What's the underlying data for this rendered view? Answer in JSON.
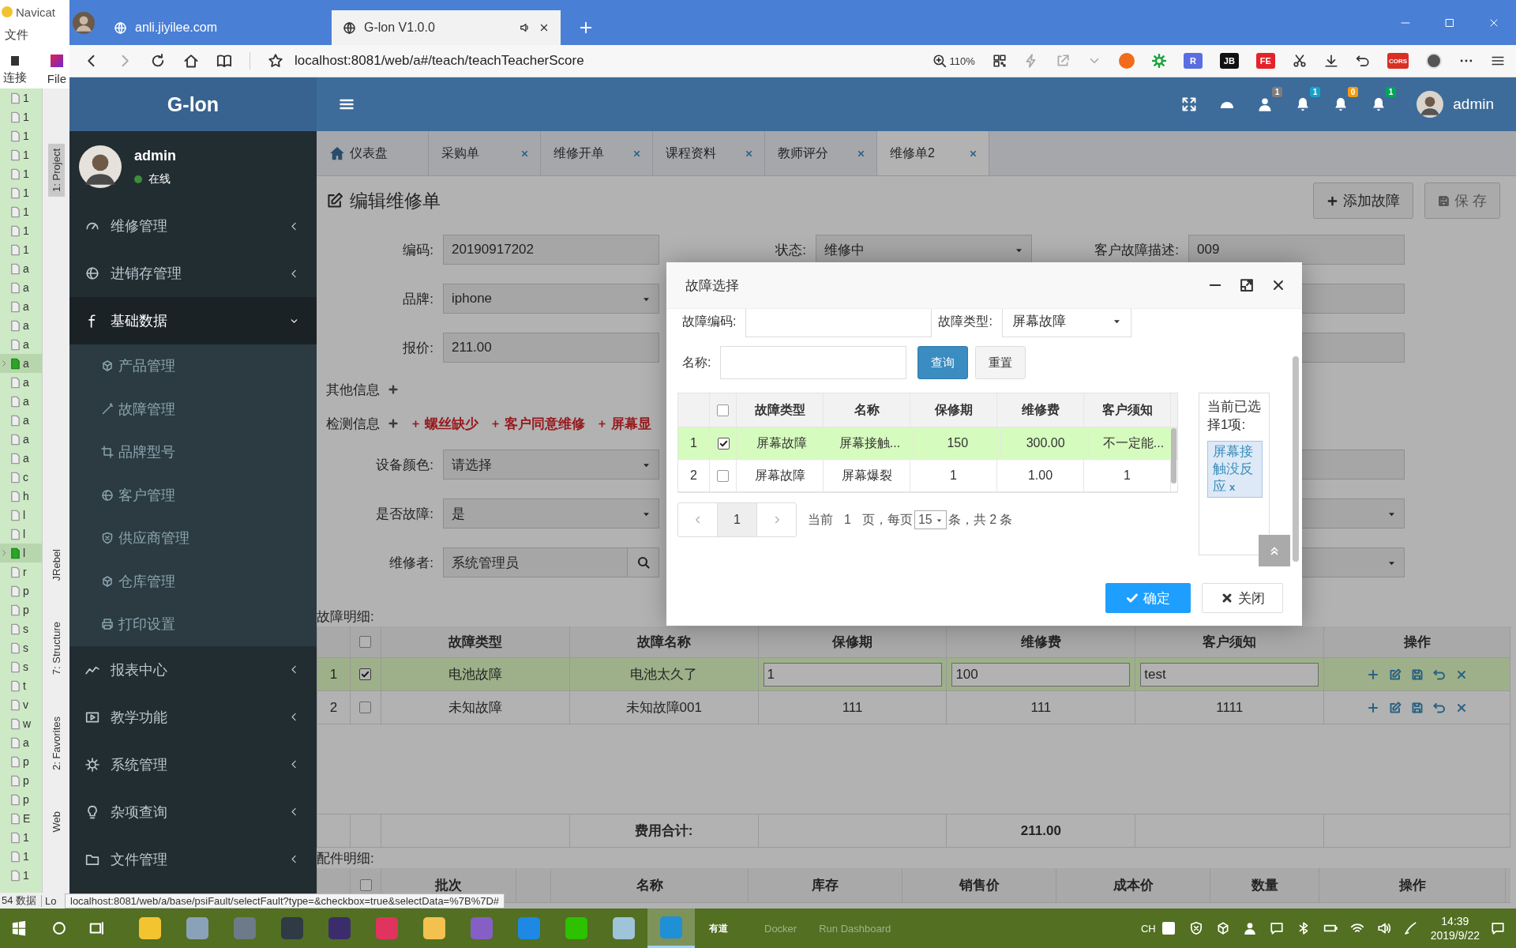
{
  "ide": {
    "app_title": "Navicat",
    "menu_item": "文件",
    "toolbar_item": "连接",
    "menu_file": "File",
    "tree_rows": [
      {
        "text": "1",
        "expandable": false
      },
      {
        "text": "1",
        "expandable": false
      },
      {
        "text": "1",
        "expandable": false
      },
      {
        "text": "1",
        "expandable": false
      },
      {
        "text": "1",
        "expandable": false
      },
      {
        "text": "1",
        "expandable": false
      },
      {
        "text": "1",
        "expandable": false
      },
      {
        "text": "1",
        "expandable": false
      },
      {
        "text": "1",
        "expandable": false
      },
      {
        "text": "a",
        "expandable": false
      },
      {
        "text": "a",
        "expandable": false
      },
      {
        "text": "a",
        "expandable": false
      },
      {
        "text": "a",
        "expandable": false
      },
      {
        "text": "a",
        "expandable": false
      },
      {
        "text": "a",
        "expandable": true
      },
      {
        "text": "a",
        "expandable": false
      },
      {
        "text": "a",
        "expandable": false
      },
      {
        "text": "a",
        "expandable": false
      },
      {
        "text": "a",
        "expandable": false
      },
      {
        "text": "a",
        "expandable": false
      },
      {
        "text": "c",
        "expandable": false
      },
      {
        "text": "h",
        "expandable": false
      },
      {
        "text": "l",
        "expandable": false
      },
      {
        "text": "l",
        "expandable": false
      },
      {
        "text": "l",
        "expandable": true
      },
      {
        "text": "r",
        "expandable": false
      },
      {
        "text": "p",
        "expandable": false
      },
      {
        "text": "p",
        "expandable": false
      },
      {
        "text": "s",
        "expandable": false
      },
      {
        "text": "s",
        "expandable": false
      },
      {
        "text": "s",
        "expandable": false
      },
      {
        "text": "t",
        "expandable": false
      },
      {
        "text": "v",
        "expandable": false
      },
      {
        "text": "w",
        "expandable": false
      },
      {
        "text": "a",
        "expandable": false
      },
      {
        "text": "p",
        "expandable": false
      },
      {
        "text": "p",
        "expandable": false
      },
      {
        "text": "p",
        "expandable": false
      },
      {
        "text": "E",
        "expandable": false
      },
      {
        "text": "1",
        "expandable": false
      },
      {
        "text": "1",
        "expandable": false
      },
      {
        "text": "1",
        "expandable": false
      }
    ],
    "tool_tabs": [
      {
        "label": "1: Project",
        "selected": true
      },
      {
        "label": "JRebel",
        "selected": false
      },
      {
        "label": "7: Structure",
        "selected": false
      },
      {
        "label": "2: Favorites",
        "selected": false
      },
      {
        "label": "Web",
        "selected": false
      }
    ],
    "status_text": "54 数据",
    "status_tab": "Lo"
  },
  "browser": {
    "tabs": [
      {
        "title": "anli.jiyilee.com",
        "selected": false
      },
      {
        "title": "G-lon V1.0.0",
        "selected": true
      }
    ],
    "url": "localhost:8081/web/a#/teach/teachTeacherScore",
    "zoom": "110%",
    "extensions": [
      {
        "label": "R",
        "color": "#5b6ee1"
      },
      {
        "label": "JB",
        "color": "#111111"
      },
      {
        "label": "FE",
        "color": "#e5222a"
      }
    ],
    "extensions_right": [
      {
        "label": "CORS",
        "color": "#d93025"
      }
    ],
    "status_url": "localhost:8081/web/a/base/psiFault/selectFault?type=&checkbox=true&selectData=%7B%7D#"
  },
  "app": {
    "logo": "G-lon",
    "user": {
      "name": "admin",
      "status": "在线"
    },
    "header_badges": [
      {
        "badge": "1",
        "color": "#7d7d7d"
      },
      {
        "badge": "1",
        "color": "#1aa1c9"
      },
      {
        "badge": "0",
        "color": "#f39c12"
      },
      {
        "badge": "1",
        "color": "#00a65a"
      }
    ],
    "header_user": "admin",
    "menu": [
      {
        "label": "维修管理",
        "selected": false,
        "expanded": false
      },
      {
        "label": "进销存管理",
        "selected": false,
        "expanded": false
      },
      {
        "label": "基础数据",
        "selected": true,
        "expanded": true,
        "children": [
          {
            "label": "产品管理"
          },
          {
            "label": "故障管理"
          },
          {
            "label": "品牌型号"
          },
          {
            "label": "客户管理"
          },
          {
            "label": "供应商管理"
          },
          {
            "label": "仓库管理"
          },
          {
            "label": "打印设置"
          }
        ]
      },
      {
        "label": "报表中心",
        "selected": false,
        "expanded": false
      },
      {
        "label": "教学功能",
        "selected": false,
        "expanded": false
      },
      {
        "label": "系统管理",
        "selected": false,
        "expanded": false
      },
      {
        "label": "杂项查询",
        "selected": false,
        "expanded": false
      },
      {
        "label": "文件管理",
        "selected": false,
        "expanded": false
      }
    ],
    "page_tabs": [
      {
        "label": "仪表盘",
        "selected": false,
        "closable": false
      },
      {
        "label": "采购单",
        "selected": false,
        "closable": true
      },
      {
        "label": "维修开单",
        "selected": false,
        "closable": true
      },
      {
        "label": "课程资料",
        "selected": false,
        "closable": true
      },
      {
        "label": "教师评分",
        "selected": false,
        "closable": true
      },
      {
        "label": "维修单2",
        "selected": true,
        "closable": true
      }
    ],
    "page_title": "编辑维修单",
    "actions": [
      {
        "label": "添加故障",
        "kind": "add"
      },
      {
        "label": "保 存",
        "kind": "save"
      }
    ],
    "form_rows": [
      [
        {
          "kind": "input",
          "label": "编码:",
          "value": "20190917202"
        },
        {
          "kind": "select",
          "label": "状态:",
          "value": "维修中"
        },
        {
          "kind": "input",
          "label": "客户故障描述:",
          "value": "009"
        }
      ],
      [
        {
          "kind": "select",
          "label": "品牌:",
          "value": "iphone"
        },
        {
          "kind": "blank"
        },
        {
          "kind": "input"
        }
      ],
      [
        {
          "kind": "input",
          "label": "报价:",
          "value": "211.00"
        },
        {
          "kind": "blank"
        },
        {
          "kind": "input"
        }
      ],
      [
        {
          "kind": "select",
          "label": "设备颜色:",
          "value": "请选择"
        },
        {
          "kind": "blank"
        },
        {
          "kind": "input"
        }
      ],
      [
        {
          "kind": "select",
          "label": "是否故障:",
          "value": "是"
        },
        {
          "kind": "blank"
        },
        {
          "kind": "select"
        }
      ],
      [
        {
          "kind": "search",
          "label": "维修者:",
          "value": "系统管理员"
        },
        {
          "kind": "blank"
        },
        {
          "kind": "select"
        }
      ]
    ],
    "other_info": "其他信息",
    "check_info": "检测信息",
    "check_tags": [
      "螺丝缺少",
      "客户同意维修",
      "屏幕显"
    ],
    "fault_section": "故障明细:",
    "fault_table": {
      "all_checked": false,
      "columns": [
        "故障类型",
        "故障名称",
        "保修期",
        "维修费",
        "客户须知",
        "操作"
      ],
      "rows": [
        {
          "no": "1",
          "checked": true,
          "selected": true,
          "editing": true,
          "cells": [
            "电池故障",
            "电池太久了",
            "1",
            "100",
            "test"
          ]
        },
        {
          "no": "2",
          "checked": false,
          "selected": false,
          "editing": false,
          "cells": [
            "未知故障",
            "未知故障001",
            "111",
            "111",
            "1111"
          ]
        }
      ],
      "total_label": "费用合计:",
      "total": "211.00"
    },
    "parts_section": "配件明细:",
    "parts_table": {
      "all_checked": false,
      "columns": [
        "批次",
        "名称",
        "库存",
        "销售价",
        "成本价",
        "数量",
        "操作"
      ]
    }
  },
  "modal": {
    "title": "故障选择",
    "code_label": "故障编码:",
    "type_label": "故障类型:",
    "type_value": "屏幕故障",
    "name_label": "名称:",
    "search_button": "查询",
    "reset_button": "重置",
    "table": {
      "all_checked": false,
      "columns": [
        "故障类型",
        "名称",
        "保修期",
        "维修费",
        "客户须知"
      ],
      "rows": [
        {
          "no": "1",
          "checked": true,
          "selected": true,
          "cells": [
            "屏幕故障",
            "屏幕接触...",
            "150",
            "300.00",
            "不一定能..."
          ]
        },
        {
          "no": "2",
          "checked": false,
          "selected": false,
          "cells": [
            "屏幕故障",
            "屏幕爆裂",
            "1",
            "1.00",
            "1"
          ]
        }
      ]
    },
    "selected_title": "当前已选择1项:",
    "selected_tags": [
      {
        "label": "屏幕接触没反应",
        "remove": "x"
      }
    ],
    "pager": {
      "pages": [
        {
          "label": "1",
          "selected": true
        }
      ],
      "current_label": "当前",
      "current": "1",
      "per_label": "页，每页",
      "per_page": "15",
      "total": "条，共 2 条"
    },
    "confirm": "确定",
    "close": "关闭"
  },
  "taskbar": {
    "apps": [
      {
        "color": "#f4c430",
        "selected": false
      },
      {
        "color": "#8aa2b8",
        "selected": false
      },
      {
        "color": "#6c7a89",
        "selected": false
      },
      {
        "color": "#2f3a44",
        "selected": false
      },
      {
        "color": "#3b2d6b",
        "selected": false
      },
      {
        "color": "#e0335e",
        "selected": false
      },
      {
        "color": "#f2c14e",
        "selected": false
      },
      {
        "color": "#865fc5",
        "selected": false
      },
      {
        "color": "#1e88e5",
        "selected": false
      },
      {
        "color": "#2dc100",
        "selected": false
      },
      {
        "color": "#9fc3d9",
        "selected": false
      },
      {
        "color": "#1f8fd6",
        "selected": true
      }
    ],
    "youdao": "有道",
    "background_items": [
      "Docker",
      "Run Dashboard"
    ],
    "input_lang": "CH",
    "time": "14:39",
    "date": "2019/9/22"
  }
}
